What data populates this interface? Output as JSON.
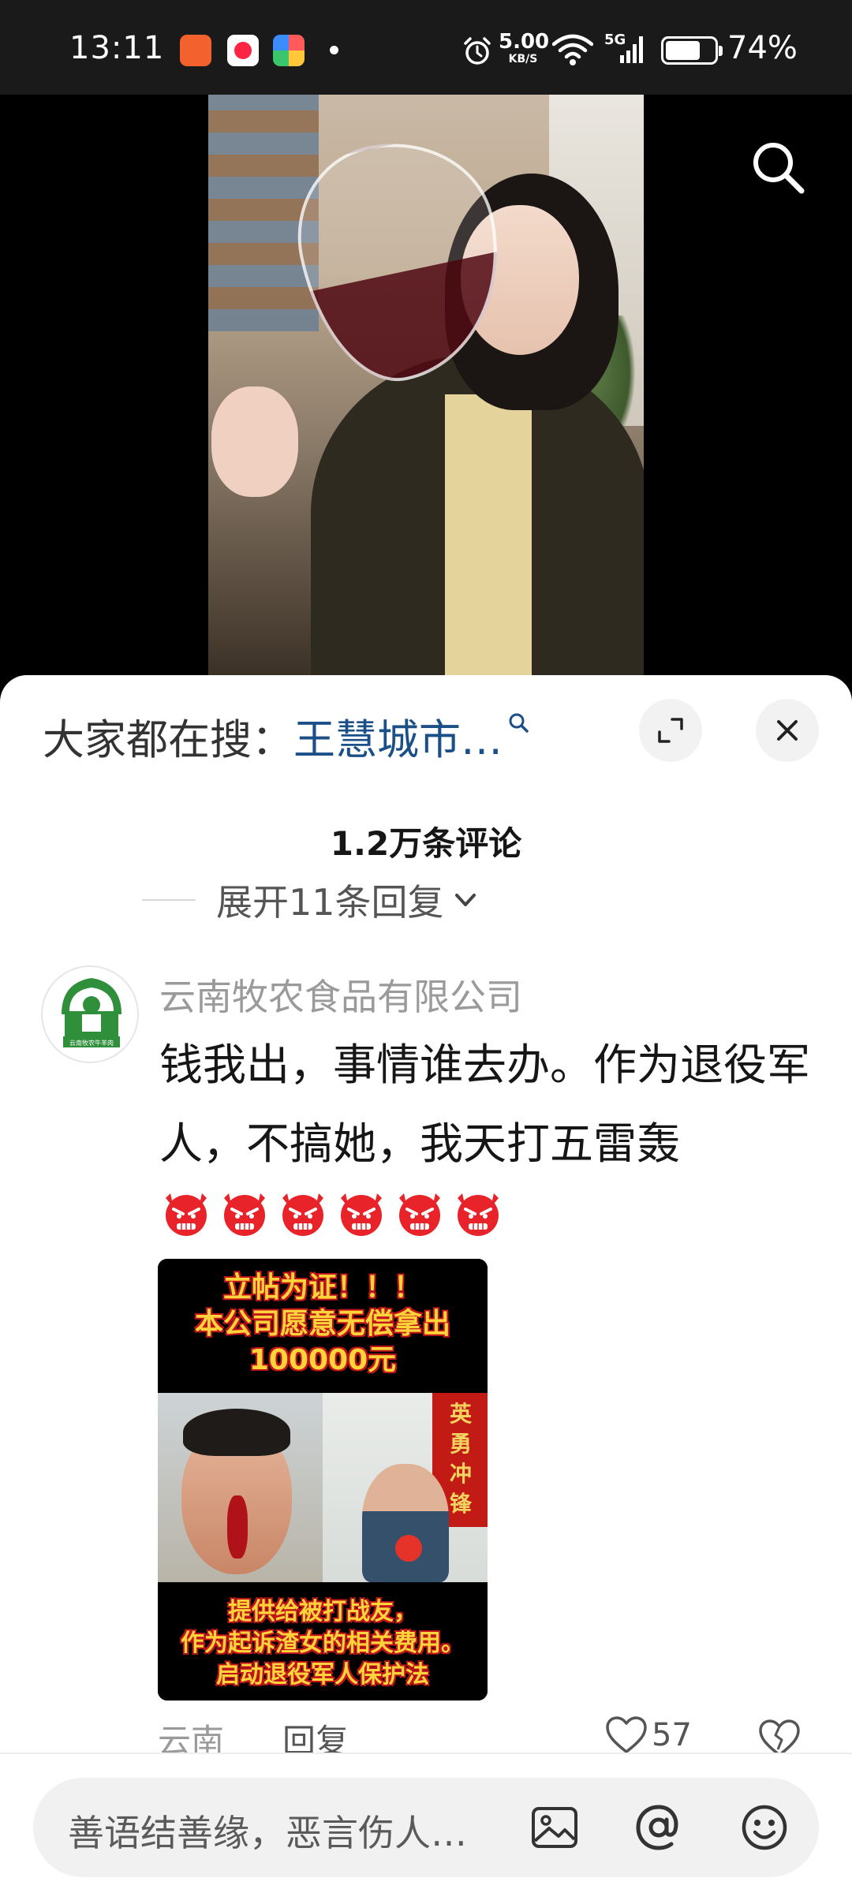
{
  "status_bar": {
    "time": "13:11",
    "net_speed_value": "5.00",
    "net_speed_unit": "KB/S",
    "signal_label": "5G",
    "battery_level": 0.74,
    "battery_percent": "74%"
  },
  "sheet_header": {
    "search_prefix": "大家都在搜：",
    "search_keyword": "王慧城市…"
  },
  "comments": {
    "count_label": "1.2万条评论",
    "expand_replies_label": "展开11条回复"
  },
  "comment": {
    "author": "云南牧农食品有限公司",
    "avatar_caption": "云南牧农牛羊肉",
    "text": "钱我出，事情谁去办。作为退役军人，不搞她，我天打五雷轰",
    "emoji_count": 6,
    "image": {
      "top_line_1": "立帖为证！！！",
      "top_line_2": "本公司愿意无偿拿出",
      "top_line_3": "100000元",
      "banner_text": "英勇冲锋",
      "bottom_line_1": "提供给被打战友，",
      "bottom_line_2": "作为起诉渣女的相关费用。",
      "bottom_line_3": "启动退役军人保护法"
    },
    "location": "云南",
    "reply_label": "回复",
    "like_count": "57"
  },
  "input": {
    "placeholder": "善语结善缘，恶言伤人…"
  },
  "icons": {
    "search": "search-icon",
    "expand": "expand-icon",
    "close": "close-icon",
    "image": "image-icon",
    "at": "at-icon",
    "emoji": "emoji-icon",
    "like": "heart-icon",
    "dislike": "broken-heart-icon"
  },
  "colors": {
    "keyword": "#1a4f88",
    "status_bar_bg": "#1a1a1a",
    "emoji_red": "#e8232a"
  }
}
